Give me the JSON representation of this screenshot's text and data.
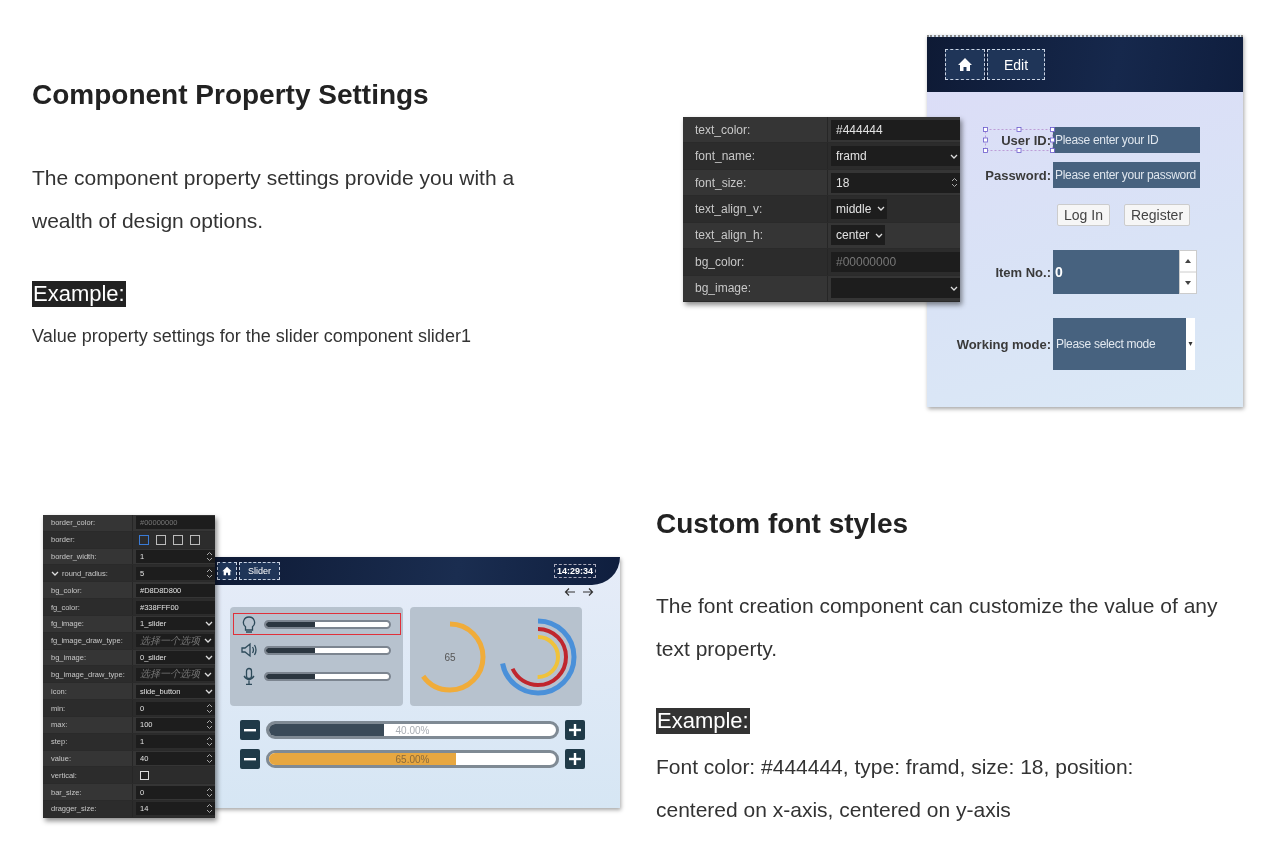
{
  "intro": {
    "heading": "Component Property Settings",
    "paragraph": "The component property settings provide you with a wealth of design options.",
    "example_label": "Example:",
    "example_text": "Value property settings for the slider component slider1"
  },
  "login_figure": {
    "properties": [
      {
        "label": "text_color:",
        "kind": "text",
        "value": "#444444"
      },
      {
        "label": "font_name:",
        "kind": "select",
        "value": "framd"
      },
      {
        "label": "font_size:",
        "kind": "spin",
        "value": "18"
      },
      {
        "label": "text_align_v:",
        "kind": "short-select",
        "value": "middle"
      },
      {
        "label": "text_align_h:",
        "kind": "short-select",
        "value": "center"
      },
      {
        "label": "bg_color:",
        "kind": "text",
        "placeholder": "#00000000"
      },
      {
        "label": "bg_image:",
        "kind": "select"
      }
    ],
    "app": {
      "breadcrumb": "Edit",
      "rows": [
        {
          "kind": "text",
          "label": "User ID:",
          "placeholder": "Please enter your ID",
          "selected": true
        },
        {
          "kind": "text",
          "label": "Password:",
          "placeholder": "Please enter your password",
          "selected": false
        },
        {
          "kind": "buttons",
          "buttons": [
            "Log In",
            "Register"
          ]
        },
        {
          "kind": "spin",
          "label": "Item No.:",
          "value": "0"
        },
        {
          "kind": "select",
          "label": "Working mode:",
          "placeholder": "Please select mode"
        }
      ]
    }
  },
  "slider_figure": {
    "properties": [
      {
        "label": "border_color:",
        "kind": "text",
        "placeholder": "#00000000"
      },
      {
        "label": "border:",
        "kind": "border",
        "options": [
          {
            "selected": true
          },
          {
            "selected": false
          },
          {
            "selected": false
          },
          {
            "selected": false
          }
        ]
      },
      {
        "label": "border_width:",
        "kind": "spin",
        "value": "1"
      },
      {
        "label": "round_radius:",
        "kind": "spin",
        "value": "5",
        "expanded": true
      },
      {
        "label": "bg_color:",
        "kind": "text",
        "value": "#D8D8D800"
      },
      {
        "label": "fg_color:",
        "kind": "text",
        "value": "#338FFF00"
      },
      {
        "label": "fg_image:",
        "kind": "select",
        "value": "1_slider"
      },
      {
        "label": "fg_image_draw_type:",
        "kind": "select",
        "placeholder": "选择一个选项"
      },
      {
        "label": "bg_image:",
        "kind": "select",
        "value": "0_slider"
      },
      {
        "label": "bg_image_draw_type:",
        "kind": "select",
        "placeholder": "选择一个选项"
      },
      {
        "label": "icon:",
        "kind": "select",
        "value": "slide_button"
      },
      {
        "label": "min:",
        "kind": "spin",
        "value": "0"
      },
      {
        "label": "max:",
        "kind": "spin",
        "value": "100"
      },
      {
        "label": "step:",
        "kind": "spin",
        "value": "1"
      },
      {
        "label": "value:",
        "kind": "spin",
        "value": "40"
      },
      {
        "label": "vertical:",
        "kind": "checkbox",
        "checked": false
      },
      {
        "label": "bar_size:",
        "kind": "spin",
        "value": "0"
      },
      {
        "label": "dragger_size:",
        "kind": "spin",
        "value": "14"
      }
    ],
    "app": {
      "breadcrumb": "Slider",
      "time": "14:29:34",
      "sliders": [
        {
          "kind": "light",
          "level": 0.4,
          "selected": true
        },
        {
          "kind": "sound",
          "level": 0.4,
          "selected": false
        },
        {
          "kind": "mic",
          "level": 0.4,
          "selected": false
        }
      ],
      "gauge": {
        "value": "65",
        "level": 0.65
      },
      "progress": [
        {
          "kind": "dark",
          "label": "40.00%",
          "level": 0.4
        },
        {
          "kind": "orange",
          "label": "65.00%",
          "level": 0.65
        }
      ]
    }
  },
  "fonts": {
    "heading": "Custom font styles",
    "paragraph": "The font creation component can customize the value of any text property.",
    "example_label": "Example:",
    "example_text": "Font color: #444444, type: framd, size: 18, position: centered on x-axis, centered on y-axis"
  }
}
